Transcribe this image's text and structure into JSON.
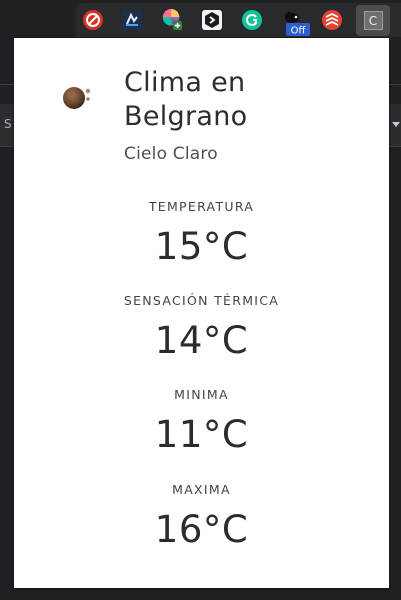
{
  "toolbar": {
    "extensions": [
      {
        "icon": "adblock-icon",
        "color": "#d93025"
      },
      {
        "icon": "bookmark-dark-icon",
        "color": "#2b3a55"
      },
      {
        "icon": "color-wheel-icon",
        "color": "#8e44ad",
        "badge": "+"
      },
      {
        "icon": "hexagon-app-icon",
        "color": "#1a1a1a"
      },
      {
        "icon": "grammarly-icon",
        "color": "#15c39a"
      },
      {
        "icon": "mole-icon",
        "color": "#111111",
        "badge": "Off"
      },
      {
        "icon": "todoist-icon",
        "color": "#e44332"
      },
      {
        "icon": "letter-c-extension-icon",
        "label": "C"
      }
    ]
  },
  "background_page": {
    "left_fragment": "S"
  },
  "popup": {
    "weather_icon": "moon-clear-sky-icon",
    "title": "Clima en Belgrano",
    "condition": "Cielo Claro",
    "stats": [
      {
        "label": "TEMPERATURA",
        "value": "15°C"
      },
      {
        "label": "SENSACIÓN TÉRMICA",
        "value": "14°C"
      },
      {
        "label": "MINIMA",
        "value": "11°C"
      },
      {
        "label": "MAXIMA",
        "value": "16°C"
      }
    ]
  }
}
